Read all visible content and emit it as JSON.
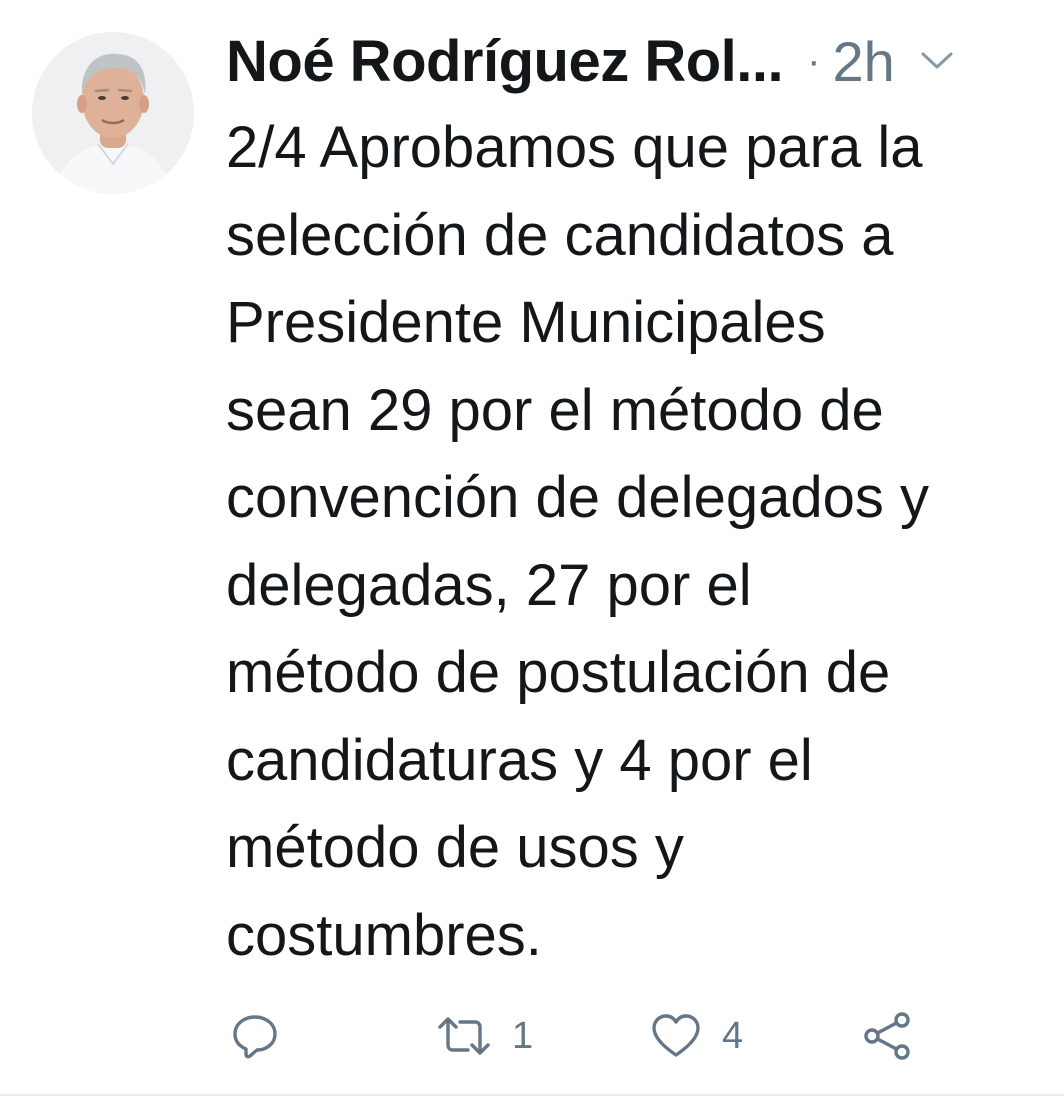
{
  "tweet": {
    "author_name": "Noé Rodríguez Rol...",
    "separator": "·",
    "timestamp": "2h",
    "text_lines": [
      "2/4 Aprobamos que para la",
      "selección de candidatos a",
      "Presidente Municipales",
      "sean 29 por el método de",
      "convención de delegados y",
      "delegadas, 27 por el",
      "método de postulación de",
      "candidaturas y 4 por el",
      "método de usos y",
      "costumbres."
    ],
    "actions": {
      "reply_count": "",
      "retweet_count": "1",
      "like_count": "4"
    }
  },
  "icons": {
    "avatar": "avatar-photo",
    "caret": "chevron-down-icon",
    "reply": "reply-icon",
    "retweet": "retweet-icon",
    "like": "heart-icon",
    "share": "share-icon"
  },
  "colors": {
    "text": "#14171a",
    "secondary": "#657786",
    "icon": "#657786",
    "divider": "#e6ecf0"
  }
}
